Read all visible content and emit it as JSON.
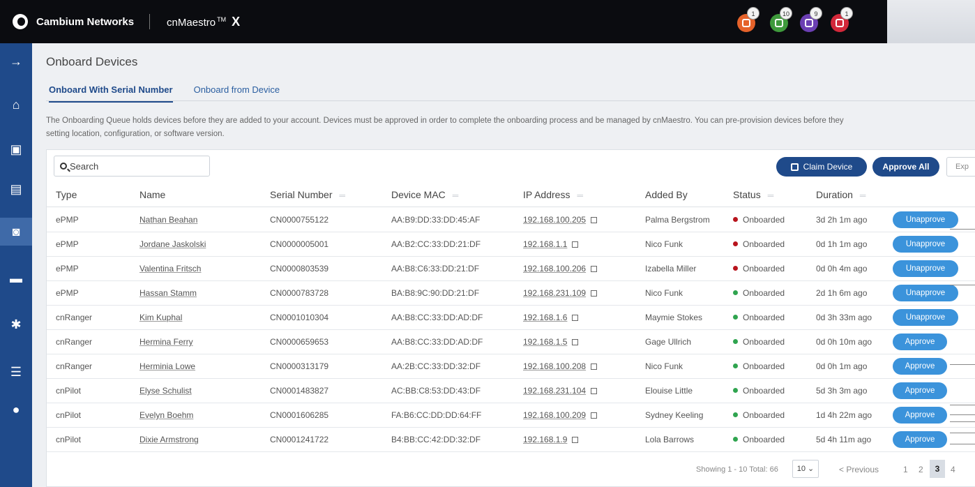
{
  "topbar": {
    "brand": "Cambium Networks",
    "product": "cnMaestro",
    "product_tm": "TM",
    "product_suffix": "X",
    "notifications": [
      {
        "icon": "alarm-icon",
        "count": "1",
        "color": "#e5622a"
      },
      {
        "icon": "device-icon",
        "count": "10",
        "color": "#3f9a3c"
      },
      {
        "icon": "task-icon",
        "count": "9",
        "color": "#6b3fb3"
      },
      {
        "icon": "sync-icon",
        "count": "1",
        "color": "#d3283a"
      }
    ]
  },
  "sidebar": {
    "items": [
      {
        "icon": "expand-arrow-icon",
        "glyph": "→"
      },
      {
        "icon": "home-icon",
        "glyph": "⌂"
      },
      {
        "icon": "monitor-icon",
        "glyph": "▣"
      },
      {
        "icon": "clipboard-icon",
        "glyph": "▤"
      },
      {
        "icon": "onboard-icon",
        "glyph": "◙"
      },
      {
        "icon": "briefcase-icon",
        "glyph": "▬"
      },
      {
        "icon": "settings-gear-icon",
        "glyph": "✱"
      },
      {
        "icon": "server-icon",
        "glyph": "☰"
      },
      {
        "icon": "user-icon",
        "glyph": "●"
      }
    ]
  },
  "page": {
    "title": "Onboard Devices",
    "tabs": [
      {
        "label": "Onboard With Serial Number",
        "active": true
      },
      {
        "label": "Onboard from Device",
        "active": false
      }
    ],
    "description_line1": "The Onboarding Queue holds devices before they are added to your account. Devices must be approved in order to complete the onboarding process and be managed by cnMaestro. You can pre-provision devices before they",
    "description_line2": "setting location, configuration, or software version."
  },
  "toolbar": {
    "search_placeholder": "Search",
    "claim_label": "Claim Device",
    "approve_all_label": "Approve All",
    "export_label": "Exp"
  },
  "table": {
    "columns": [
      "Type",
      "Name",
      "Serial Number",
      "Device MAC",
      "IP Address",
      "Added By",
      "Status",
      "Duration"
    ],
    "rows": [
      {
        "type": "ePMP",
        "name": "Nathan Beahan",
        "serial": "CN0000755122",
        "mac": "AA:B9:DD:33:DD:45:AF",
        "ip": "192.168.100.205",
        "added_by": "Palma Bergstrom",
        "status": "Onboarded",
        "status_color": "red",
        "duration": "3d 2h 1m ago",
        "action": "Unapprove"
      },
      {
        "type": "ePMP",
        "name": "Jordane Jaskolski",
        "serial": "CN0000005001",
        "mac": "AA:B2:CC:33:DD:21:DF",
        "ip": "192.168.1.1",
        "added_by": "Nico Funk",
        "status": "Onboarded",
        "status_color": "red",
        "duration": "0d 1h 1m ago",
        "action": "Unapprove"
      },
      {
        "type": "ePMP",
        "name": "Valentina Fritsch",
        "serial": "CN0000803539",
        "mac": "AA:B8:C6:33:DD:21:DF",
        "ip": "192.168.100.206",
        "added_by": "Izabella Miller",
        "status": "Onboarded",
        "status_color": "red",
        "duration": "0d 0h 4m ago",
        "action": "Unapprove"
      },
      {
        "type": "ePMP",
        "name": "Hassan Stamm",
        "serial": "CN0000783728",
        "mac": "BA:B8:9C:90:DD:21:DF",
        "ip": "192.168.231.109",
        "added_by": "Nico Funk",
        "status": "Onboarded",
        "status_color": "green",
        "duration": "2d 1h 6m ago",
        "action": "Unapprove"
      },
      {
        "type": "cnRanger",
        "name": "Kim Kuphal",
        "serial": "CN0001010304",
        "mac": "AA:B8:CC:33:DD:AD:DF",
        "ip": "192.168.1.6",
        "added_by": "Maymie Stokes",
        "status": "Onboarded",
        "status_color": "green",
        "duration": "0d 3h 33m ago",
        "action": "Unapprove"
      },
      {
        "type": "cnRanger",
        "name": "Hermina Ferry",
        "serial": "CN0000659653",
        "mac": "AA:B8:CC:33:DD:AD:DF",
        "ip": "192.168.1.5",
        "added_by": "Gage Ullrich",
        "status": "Onboarded",
        "status_color": "green",
        "duration": "0d 0h 10m ago",
        "action": "Approve"
      },
      {
        "type": "cnRanger",
        "name": "Herminia Lowe",
        "serial": "CN0000313179",
        "mac": "AA:2B:CC:33:DD:32:DF",
        "ip": "192.168.100.208",
        "added_by": "Nico Funk",
        "status": "Onboarded",
        "status_color": "green",
        "duration": "0d 0h 1m ago",
        "action": "Approve"
      },
      {
        "type": "cnPilot",
        "name": "Elyse Schulist",
        "serial": "CN0001483827",
        "mac": "AC:BB:C8:53:DD:43:DF",
        "ip": "192.168.231.104",
        "added_by": "Elouise Little",
        "status": "Onboarded",
        "status_color": "green",
        "duration": "5d 3h 3m ago",
        "action": "Approve"
      },
      {
        "type": "cnPilot",
        "name": "Evelyn Boehm",
        "serial": "CN0001606285",
        "mac": "FA:B6:CC:DD:DD:64:FF",
        "ip": "192.168.100.209",
        "added_by": "Sydney Keeling",
        "status": "Onboarded",
        "status_color": "green",
        "duration": "1d 4h 22m ago",
        "action": "Approve"
      },
      {
        "type": "cnPilot",
        "name": "Dixie Armstrong",
        "serial": "CN0001241722",
        "mac": "B4:BB:CC:42:DD:32:DF",
        "ip": "192.168.1.9",
        "added_by": "Lola Barrows",
        "status": "Onboarded",
        "status_color": "green",
        "duration": "5d 4h 11m ago",
        "action": "Approve"
      }
    ]
  },
  "pagination": {
    "showing": "Showing 1 - 10 Total: 66",
    "page_size": "10",
    "prev_label": "< Previous",
    "pages": [
      "1",
      "2",
      "3",
      "4"
    ],
    "current_page": "3"
  }
}
